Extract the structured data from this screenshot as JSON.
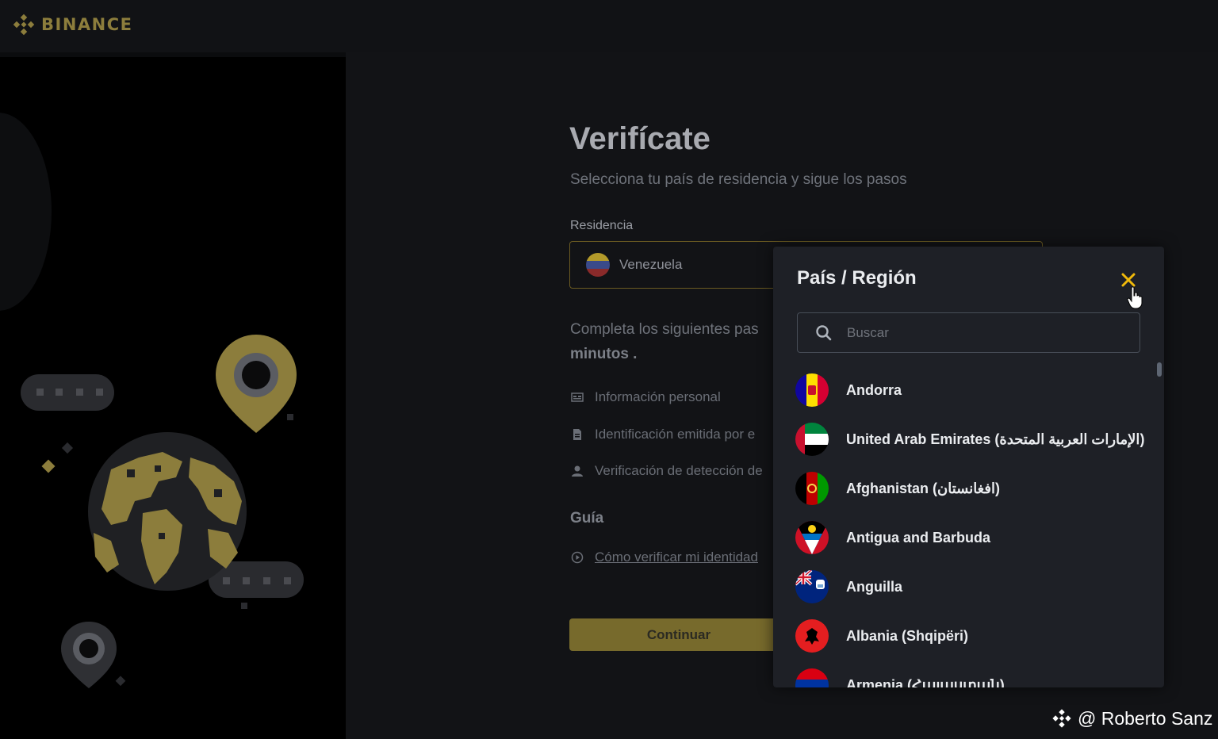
{
  "brand": {
    "name": "BINANCE",
    "accent": "#f0b90b"
  },
  "page": {
    "title": "Verifícate",
    "subtitle": "Selecciona tu país de residencia y sigue los pasos",
    "residence_label": "Residencia",
    "residence_value": "Venezuela",
    "steps_intro": "Completa los siguientes pas",
    "steps_intro_bold": "minutos",
    "steps_intro_end": " .",
    "steps": [
      {
        "label": "Información personal",
        "icon": "id-card-icon"
      },
      {
        "label": "Identificación emitida por e",
        "icon": "document-icon"
      },
      {
        "label": "Verificación de detección de",
        "icon": "user-icon"
      }
    ],
    "guide_title": "Guía",
    "guide_link": "Cómo verificar mi identidad",
    "continue_label": "Continuar"
  },
  "modal": {
    "title": "País / Región",
    "search_placeholder": "Buscar",
    "countries": [
      "Andorra",
      "United Arab Emirates (الإمارات العربية المتحدة)",
      "Afghanistan (افغانستان)",
      "Antigua and Barbuda",
      "Anguilla",
      "Albania (Shqipëri)",
      "Armenia (Հայաստան)"
    ]
  },
  "watermark": "@ Roberto Sanz"
}
